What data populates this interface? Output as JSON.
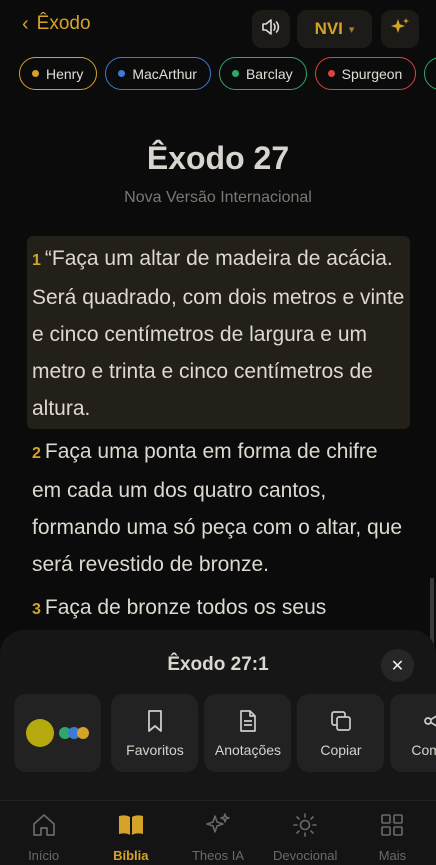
{
  "header": {
    "back_label": "Êxodo",
    "version": "NVI",
    "icons": {
      "back": "chevron-left-icon",
      "sound": "speaker-icon",
      "version_caret": "chevron-down-icon",
      "ai": "sparkles-icon"
    }
  },
  "commentators": [
    {
      "label": "Henry",
      "color": "#d4a328"
    },
    {
      "label": "MacArthur",
      "color": "#3d7bd6"
    },
    {
      "label": "Barclay",
      "color": "#2fa86a"
    },
    {
      "label": "Spurgeon",
      "color": "#d94545"
    },
    {
      "label": "",
      "color": "#2fa86a"
    }
  ],
  "chapter": {
    "title": "Êxodo 27",
    "translation": "Nova Versão Internacional"
  },
  "verses": [
    {
      "num": "1",
      "text": "“Faça um altar de madeira de acácia. Será quadrado, com dois metros e vinte e cinco centímetros de largura e um metro e trinta e cinco centímetros de altura.",
      "selected": true
    },
    {
      "num": "2",
      "text": "Faça uma ponta em forma de chifre em cada um dos quatro cantos, formando uma só peça com o altar, que será revestido de bronze.",
      "selected": false
    },
    {
      "num": "3",
      "text": "Faça de bronze todos os seus",
      "selected": false
    }
  ],
  "sheet": {
    "title": "Êxodo 27:1",
    "highlight_colors": [
      "#b5a90e",
      "#2fa86a",
      "#3d7bd6",
      "#d4a328"
    ],
    "actions": [
      {
        "label": "Favoritos",
        "icon": "bookmark-icon"
      },
      {
        "label": "Anotações",
        "icon": "note-icon"
      },
      {
        "label": "Copiar",
        "icon": "copy-icon"
      },
      {
        "label": "Compa",
        "icon": "share-icon"
      }
    ]
  },
  "nav": [
    {
      "label": "Início",
      "icon": "home-icon",
      "active": false
    },
    {
      "label": "Bíblia",
      "icon": "book-icon",
      "active": true
    },
    {
      "label": "Theos IA",
      "icon": "sparkles-icon",
      "active": false
    },
    {
      "label": "Devocional",
      "icon": "sun-icon",
      "active": false
    },
    {
      "label": "Mais",
      "icon": "grid-icon",
      "active": false
    }
  ]
}
